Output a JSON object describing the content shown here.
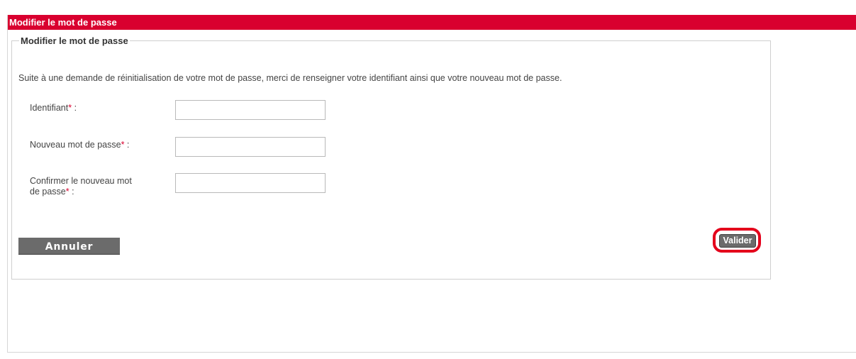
{
  "header": {
    "title": "Modifier le mot de passe"
  },
  "form": {
    "legend": "Modifier le mot de passe",
    "intro": "Suite à une demande de réinitialisation de votre mot de passe, merci de renseigner votre identifiant ainsi que votre nouveau mot de passe.",
    "required_marker": "*",
    "colon": " :",
    "fields": [
      {
        "label": "Identifiant",
        "value": ""
      },
      {
        "label": "Nouveau mot de passe",
        "value": ""
      },
      {
        "label_line1": "Confirmer le nouveau mot",
        "label_line2": "de passe",
        "value": ""
      }
    ],
    "cancel_label": "Annuler",
    "validate_label": "Valider"
  },
  "colors": {
    "brand_red": "#d9002f",
    "button_gray": "#6b6b6b",
    "highlight_red": "#e4001b"
  }
}
